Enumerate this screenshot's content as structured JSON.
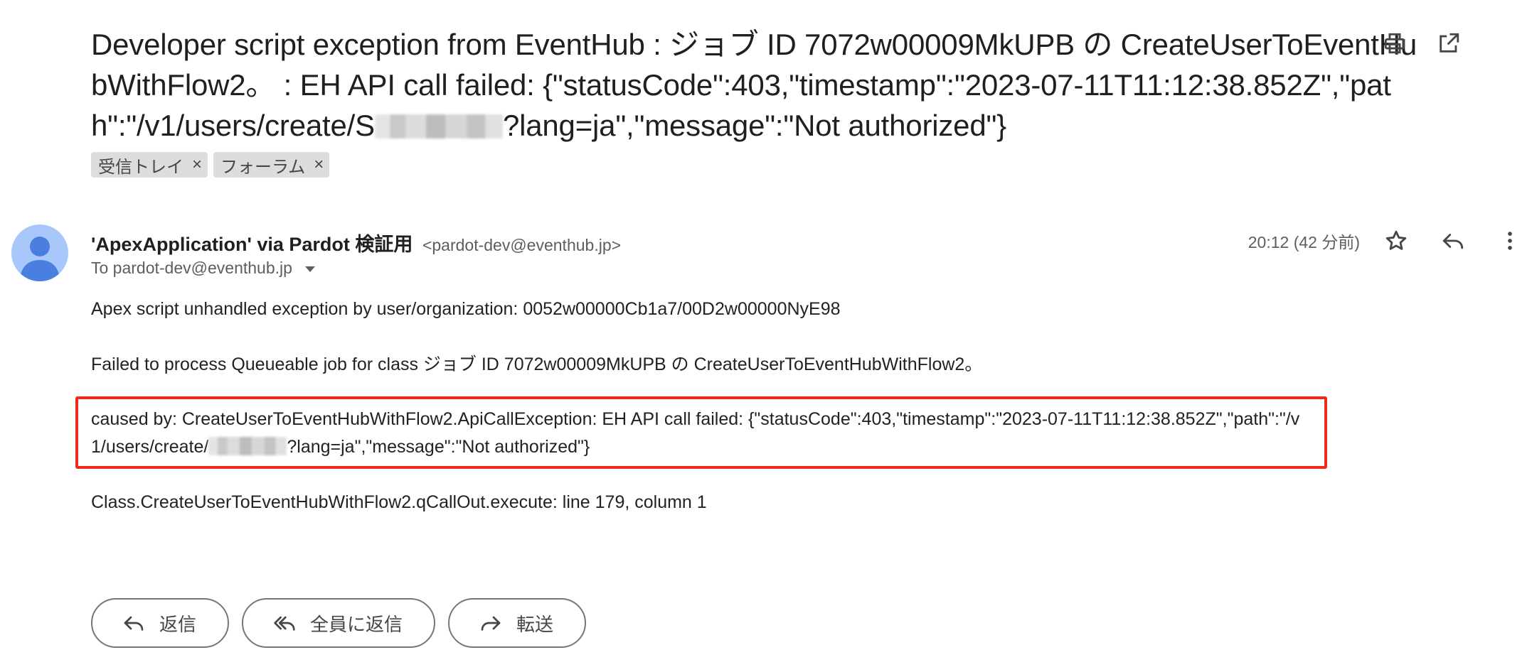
{
  "subject": {
    "prefix": "Developer script exception from EventHub : ジョブ ID 7072w00009MkUPB の CreateUserToEventHubWithFlow2。 : EH API call failed: {\"statusCode\":403,\"timestamp\":\"2023-07-11T11:12:38.852Z\",\"path\":\"/v1/users/create/S",
    "suffix": "?lang=ja\",\"message\":\"Not authorized\"}"
  },
  "labels": [
    {
      "name": "受信トレイ",
      "remove": "×"
    },
    {
      "name": "フォーラム",
      "remove": "×"
    }
  ],
  "sender": {
    "name": "'ApexApplication' via Pardot 検証用",
    "email": "<pardot-dev@eventhub.jp>",
    "to": "To pardot-dev@eventhub.jp"
  },
  "timestamp": "20:12 (42 分前)",
  "body": {
    "line1": "Apex script unhandled exception by user/organization: 0052w00000Cb1a7/00D2w00000NyE98",
    "line2": "Failed to process Queueable job for class ジョブ ID 7072w00009MkUPB の CreateUserToEventHubWithFlow2。",
    "line3_prefix": "caused by: CreateUserToEventHubWithFlow2.ApiCallException: EH API call failed: {\"statusCode\":403,\"timestamp\":\"2023-07-11T11:12:38.852Z\",\"path\":\"/v1/users/create/",
    "line3_suffix": "?lang=ja\",\"message\":\"Not authorized\"}",
    "line4": "Class.CreateUserToEventHubWithFlow2.qCallOut.execute: line 179, column 1"
  },
  "actions": {
    "reply": "返信",
    "reply_all": "全員に返信",
    "forward": "転送"
  },
  "colors": {
    "highlight": "#ee2a1b",
    "avatar_bg": "#a8c7fa",
    "avatar_fg": "#4a7fe0"
  },
  "icons": {
    "print": "print-icon",
    "open_new_window": "open-in-new-icon",
    "star": "star-icon",
    "reply": "reply-icon",
    "more": "more-vert-icon",
    "reply_all": "reply-all-icon",
    "forward": "forward-icon"
  }
}
